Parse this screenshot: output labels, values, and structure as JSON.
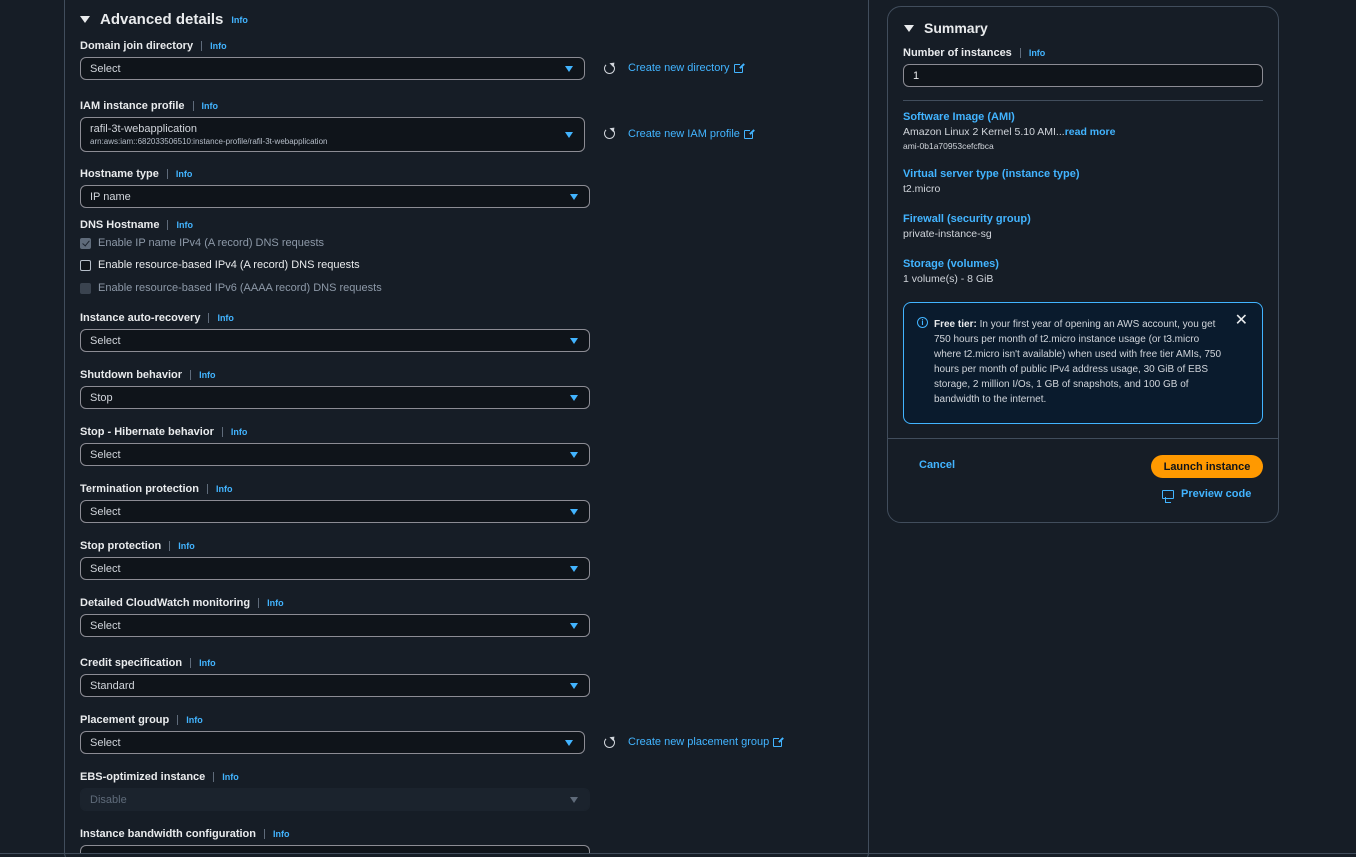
{
  "advanced": {
    "title": "Advanced details",
    "info": "Info",
    "domain_join": {
      "label": "Domain join directory",
      "value": "Select",
      "create_link": "Create new directory"
    },
    "iam_profile": {
      "label": "IAM instance profile",
      "value": "rafil-3t-webapplication",
      "arn": "arn:aws:iam::682033506510:instance-profile/rafil-3t-webapplication",
      "create_link": "Create new IAM profile"
    },
    "hostname_type": {
      "label": "Hostname type",
      "value": "IP name"
    },
    "dns_hostname": {
      "label": "DNS Hostname",
      "options": [
        {
          "label": "Enable IP name IPv4 (A record) DNS requests",
          "checked": true,
          "disabled": true
        },
        {
          "label": "Enable resource-based IPv4 (A record) DNS requests",
          "checked": false,
          "disabled": false
        },
        {
          "label": "Enable resource-based IPv6 (AAAA record) DNS requests",
          "checked": false,
          "disabled": true
        }
      ]
    },
    "auto_recovery": {
      "label": "Instance auto-recovery",
      "value": "Select"
    },
    "shutdown": {
      "label": "Shutdown behavior",
      "value": "Stop"
    },
    "hibernate": {
      "label": "Stop - Hibernate behavior",
      "value": "Select"
    },
    "termination": {
      "label": "Termination protection",
      "value": "Select"
    },
    "stop_protection": {
      "label": "Stop protection",
      "value": "Select"
    },
    "cloudwatch": {
      "label": "Detailed CloudWatch monitoring",
      "value": "Select"
    },
    "credit": {
      "label": "Credit specification",
      "value": "Standard"
    },
    "placement": {
      "label": "Placement group",
      "value": "Select",
      "create_link": "Create new placement group"
    },
    "ebs": {
      "label": "EBS-optimized instance",
      "value": "Disable"
    },
    "bandwidth": {
      "label": "Instance bandwidth configuration"
    }
  },
  "summary": {
    "title": "Summary",
    "info": "Info",
    "instances_label": "Number of instances",
    "instances_value": "1",
    "ami_label": "Software Image (AMI)",
    "ami_value": "Amazon Linux 2 Kernel 5.10 AMI...",
    "ami_read_more": "read more",
    "ami_id": "ami-0b1a70953cefcfbca",
    "type_label": "Virtual server type (instance type)",
    "type_value": "t2.micro",
    "firewall_label": "Firewall (security group)",
    "firewall_value": "private-instance-sg",
    "storage_label": "Storage (volumes)",
    "storage_value": "1 volume(s) - 8 GiB",
    "free_tier_title": "Free tier:",
    "free_tier_text": "In your first year of opening an AWS account, you get 750 hours per month of t2.micro instance usage (or t3.micro where t2.micro isn't available) when used with free tier AMIs, 750 hours per month of public IPv4 address usage, 30 GiB of EBS storage, 2 million I/Os, 1 GB of snapshots, and 100 GB of bandwidth to the internet.",
    "cancel": "Cancel",
    "launch": "Launch instance",
    "preview": "Preview code"
  },
  "colors": {
    "background": "#161d26",
    "accent": "#42b4ff",
    "primary_button": "#ff9900",
    "border": "#414d5c"
  },
  "icons": [
    "refresh-icon",
    "external-link-icon",
    "info-circle-icon",
    "close-icon",
    "code-icon",
    "caret-down-icon"
  ]
}
